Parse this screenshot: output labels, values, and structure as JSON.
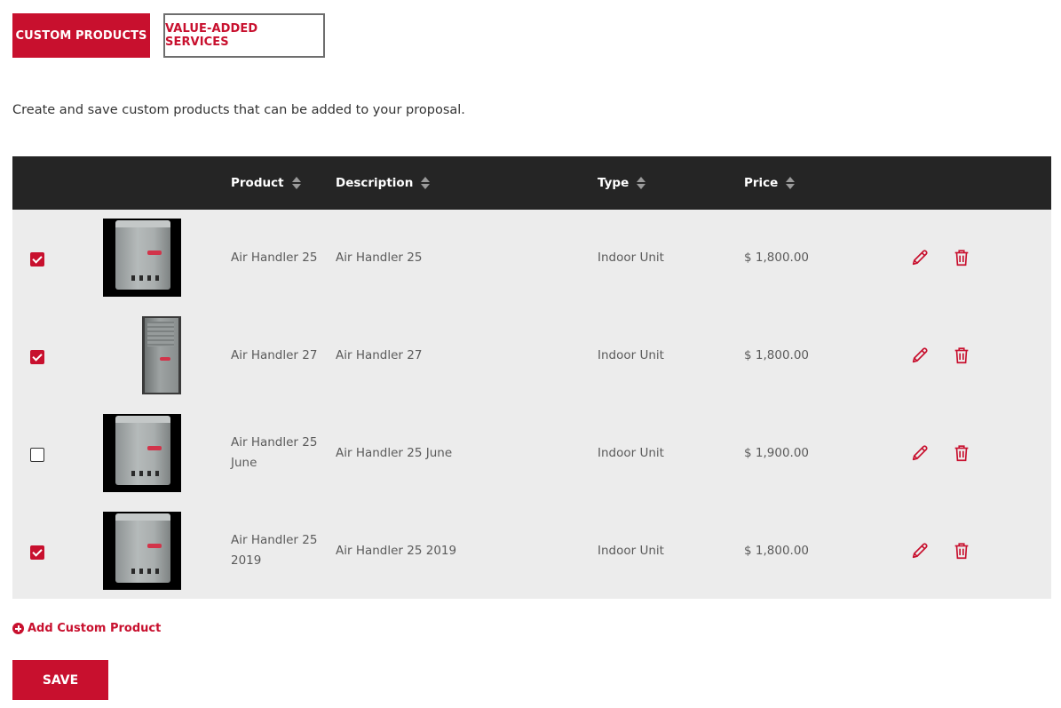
{
  "tabs": {
    "custom_products": "CUSTOM PRODUCTS",
    "value_added_services": "VALUE-ADDED SERVICES"
  },
  "intro": "Create and save custom products that can be added to your proposal.",
  "table": {
    "headers": {
      "product": "Product",
      "description": "Description",
      "type": "Type",
      "price": "Price"
    },
    "rows": [
      {
        "checked": true,
        "image": "air-handler-cube",
        "product_line1": "Air Handler 25",
        "product_line2": "",
        "description": "Air Handler 25",
        "type": "Indoor Unit",
        "price": "$ 1,800.00"
      },
      {
        "checked": true,
        "image": "air-handler-tall",
        "product_line1": "Air Handler 27",
        "product_line2": "",
        "description": "Air Handler 27",
        "type": "Indoor Unit",
        "price": "$ 1,800.00"
      },
      {
        "checked": false,
        "image": "air-handler-cube",
        "product_line1": "Air Handler 25",
        "product_line2": "June",
        "description": "Air Handler 25 June",
        "type": "Indoor Unit",
        "price": "$ 1,900.00"
      },
      {
        "checked": true,
        "image": "air-handler-cube",
        "product_line1": "Air Handler 25",
        "product_line2": "2019",
        "description": "Air Handler 25 2019",
        "type": "Indoor Unit",
        "price": "$ 1,800.00"
      }
    ],
    "row_icons": {
      "edit": "pencil-icon",
      "delete": "trash-icon"
    }
  },
  "add_link": "Add Custom Product",
  "save": "SAVE",
  "colors": {
    "accent": "#c8102e",
    "header_bg": "#252525",
    "body_bg": "#ececec"
  }
}
